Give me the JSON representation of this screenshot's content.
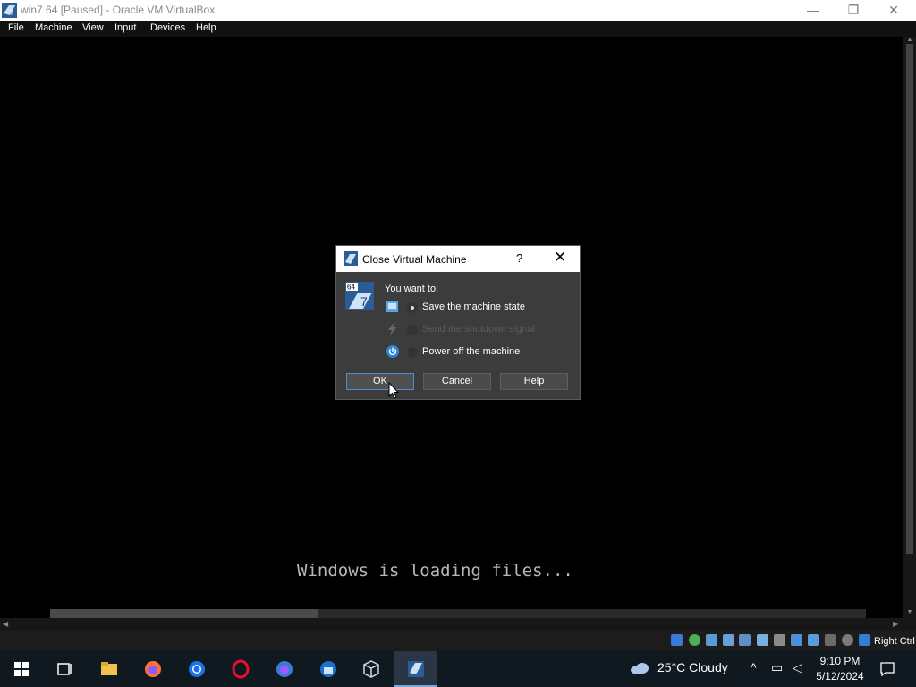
{
  "window": {
    "title": "win7 64 [Paused] - Oracle VM VirtualBox",
    "controls": [
      "—",
      "❐",
      "✕"
    ]
  },
  "menu": [
    "File",
    "Machine",
    "View",
    "Input",
    "Devices",
    "Help"
  ],
  "vm_screen": {
    "loading_text": "Windows is loading files..."
  },
  "dialog": {
    "title": "Close Virtual Machine",
    "help_glyph": "?",
    "close_glyph": "✕",
    "prompt": "You want to:",
    "options": [
      {
        "label": "Save the machine state",
        "selected": true,
        "enabled": true
      },
      {
        "label": "Send the shutdown signal",
        "selected": false,
        "enabled": false
      },
      {
        "label": "Power off the machine",
        "selected": false,
        "enabled": true
      }
    ],
    "buttons": {
      "ok": "OK",
      "cancel": "Cancel",
      "help": "Help"
    }
  },
  "statusbar": {
    "host_key": "Right Ctrl",
    "icons": [
      "hard-disk-icon",
      "optical-drive-icon",
      "floppy-icon",
      "audio-icon",
      "network-icon",
      "usb-icon",
      "shared-folders-icon",
      "display-icon",
      "video-capture-icon",
      "cpu-icon",
      "mouse-integration-icon",
      "keyboard-icon"
    ]
  },
  "taskbar": {
    "apps": [
      "start",
      "task-view",
      "file-explorer",
      "firefox",
      "chrome",
      "opera",
      "firefox-developer",
      "thunderbird",
      "virtualbox",
      "virtualbox-vm"
    ],
    "weather": "25°C  Cloudy",
    "time": "9:10 PM",
    "date": "5/12/2024"
  },
  "colors": {
    "accent": "#4f8fd0",
    "dialog_bg": "#3c3c3c",
    "taskbar_bg": "#101820"
  }
}
